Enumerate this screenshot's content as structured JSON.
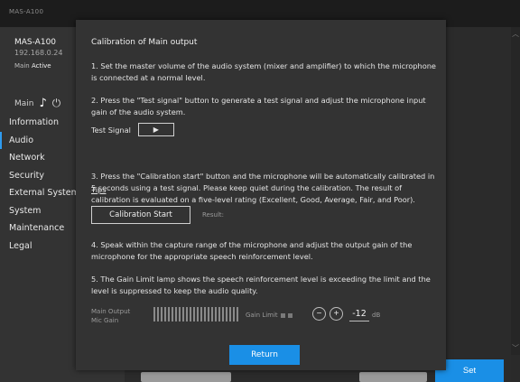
{
  "topbar": {
    "product": "MAS-A100"
  },
  "device": {
    "name": "MAS-A100",
    "ip": "192.168.0.24",
    "status_label": "Main",
    "status_value": "Active",
    "control_label": "Main"
  },
  "nav": {
    "items": [
      "Information",
      "Audio",
      "Network",
      "Security",
      "External System",
      "System",
      "Maintenance",
      "Legal"
    ],
    "active": "Audio"
  },
  "footer": {
    "set_label": "Set"
  },
  "modal": {
    "title": "Calibration of Main output",
    "step1": "1. Set the master volume of the audio system (mixer and amplifier) to which the microphone is connected at a normal level.",
    "step2": "2. Press the \"Test signal\" button to generate a test signal and adjust the microphone input gain of the audio system.",
    "test_signal_label": "Test Signal",
    "step3": "3. Press the \"Calibration start\" button and the microphone will be automatically calibrated in 5 seconds using a test signal. Please keep quiet during the calibration. The result of calibration is evaluated on a five-level rating (Excellent, Good, Average, Fair, and Poor).",
    "tips_label": "Tips",
    "calibration_start_label": "Calibration Start",
    "result_label": "Result:",
    "step4": "4. Speak within the capture range of the microphone and adjust the output gain of the microphone for the appropriate speech reinforcement level.",
    "step5": "5. The Gain Limit lamp shows the speech reinforcement level is exceeding the limit and the level is suppressed to keep the audio quality.",
    "meter_label_1": "Main Output",
    "meter_label_2": "Mic Gain",
    "gain_limit_label": "Gain Limit",
    "mic_gain_value": "-12",
    "mic_gain_unit": "dB",
    "return_label": "Return"
  }
}
